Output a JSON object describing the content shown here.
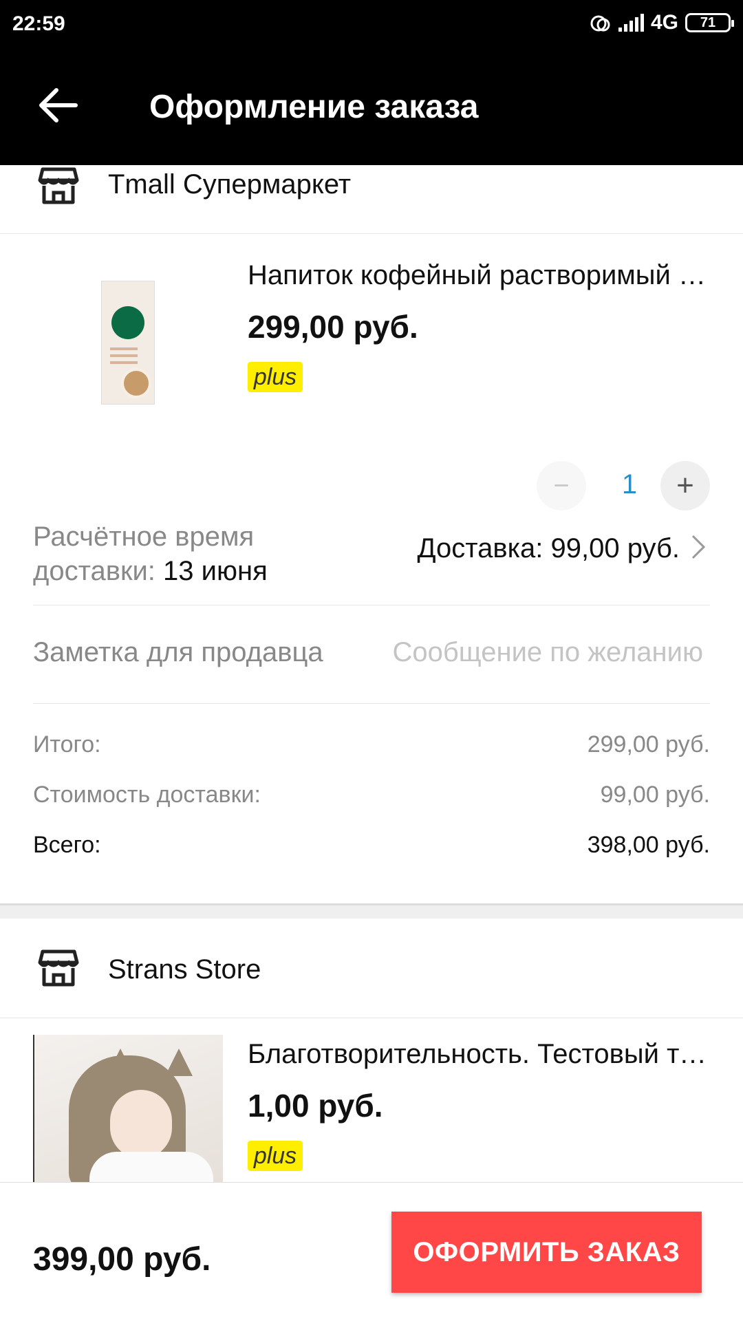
{
  "status_bar": {
    "time": "22:59",
    "network": "4G",
    "battery": "71"
  },
  "header": {
    "title": "Оформление заказа"
  },
  "store1": {
    "name": "Tmall Супермаркет",
    "item": {
      "title": "Напиток кофейный растворимый Starbucks Caffe Latte",
      "price": "299,00 руб.",
      "badge": "plus",
      "quantity": "1"
    },
    "delivery": {
      "label": "Расчётное время доставки:",
      "date": "13 июня",
      "price": "Доставка: 99,00 руб."
    },
    "note": {
      "label": "Заметка для продавца",
      "placeholder": "Сообщение по желанию"
    },
    "totals": {
      "subtotal_label": "Итого:",
      "subtotal_value": "299,00 руб.",
      "shipping_label": "Стоимость доставки:",
      "shipping_value": "99,00 руб.",
      "total_label": "Всего:",
      "total_value": "398,00 руб."
    }
  },
  "store2": {
    "name": "Strans Store",
    "item": {
      "title": "Благотворительность. Тестовый товар",
      "price": "1,00 руб.",
      "badge": "plus"
    }
  },
  "footer": {
    "total": "399,00 руб.",
    "checkout_label": "ОФОРМИТЬ ЗАКАЗ"
  },
  "colors": {
    "accent": "#ff4747",
    "badge": "#ffee00",
    "qty": "#2b8dc8"
  }
}
